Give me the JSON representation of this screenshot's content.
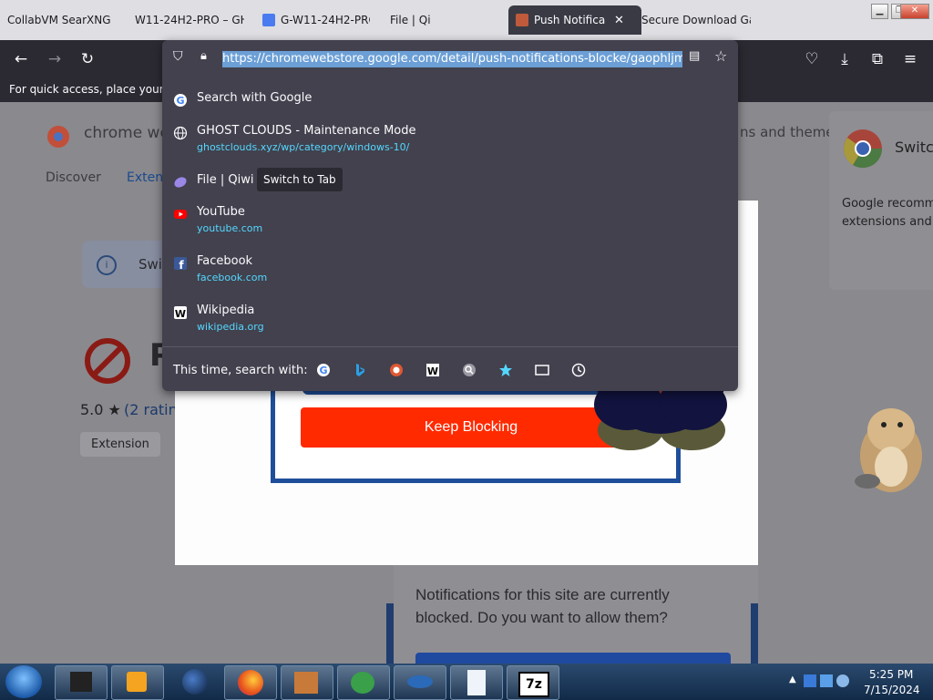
{
  "tabs": [
    {
      "label": "CollabVM SearXNG"
    },
    {
      "label": "W11-24H2-PRO – GHO"
    },
    {
      "label": "G-W11-24H2-PRO"
    },
    {
      "label": "File | Qi"
    },
    {
      "label": "Push Notificati"
    },
    {
      "label": "Secure Download Gat"
    }
  ],
  "url": "https://chromewebstore.google.com/detail/push-notifications-blocke/gaophljmnng",
  "bookmarks_hint": "For quick access, place your boo",
  "dropdown": {
    "search_label": "Search with Google",
    "results": [
      {
        "title": "GHOST CLOUDS - Maintenance Mode",
        "url": "ghostclouds.xyz/wp/category/windows-10/"
      },
      {
        "title": "File | Qiwi",
        "url": ""
      },
      {
        "title": "YouTube",
        "url": "youtube.com"
      },
      {
        "title": "Facebook",
        "url": "facebook.com"
      },
      {
        "title": "Wikipedia",
        "url": "wikipedia.org"
      }
    ],
    "switch_tab_tooltip": "Switch to Tab",
    "one_off_label": "This time, search with:"
  },
  "page": {
    "store_title": "chrome we",
    "nav_discover": "Discover",
    "nav_extensions": "Exten",
    "info_banner": "Swi",
    "right_title": "ns and themes",
    "side_card_title": "Switc",
    "side_card_text": "Google recomm extensions and t",
    "rating": "5.0 ★",
    "rating_link": "(2 rating",
    "tag": "Extension",
    "big_letter": "P",
    "keep_blocking": "Keep Blocking",
    "notif_text": "Notifications for this site are currently blocked. Do you want to allow them?"
  },
  "clock": {
    "time": "5:25 PM",
    "date": "7/15/2024"
  },
  "colors": {
    "accent": "#54d7ff",
    "keep_blocking": "#ff2a00",
    "panel": "#42414d"
  }
}
